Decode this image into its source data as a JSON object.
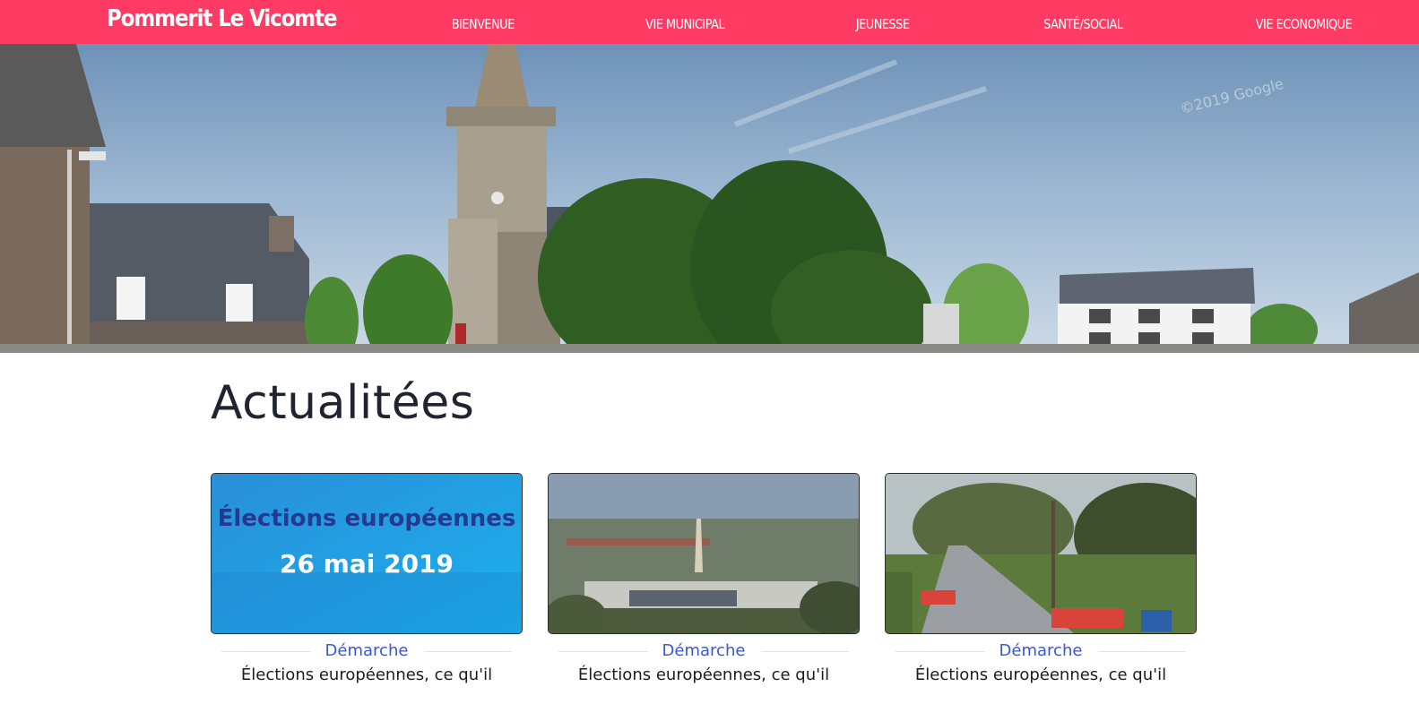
{
  "site": {
    "brand": "Pommerit Le Vicomte"
  },
  "nav": {
    "items": [
      {
        "label": "BIENVENUE"
      },
      {
        "label": "VIE MUNICIPAL"
      },
      {
        "label": "JEUNESSE"
      },
      {
        "label": "SANTÉ/SOCIAL"
      },
      {
        "label": "VIE ECONOMIQUE"
      }
    ]
  },
  "hero": {
    "watermark": "©2019 Google"
  },
  "news": {
    "title": "Actualitées",
    "cards": [
      {
        "category": "Démarche",
        "title": "Élections européennes, ce qu'il",
        "image_line1": "Élections européennes",
        "image_line2": "26 mai 2019"
      },
      {
        "category": "Démarche",
        "title": "Élections européennes, ce qu'il"
      },
      {
        "category": "Démarche",
        "title": "Élections européennes, ce qu'il"
      }
    ]
  },
  "colors": {
    "brand": "#ff3a63",
    "category": "#3b57d6",
    "heading": "#1f2430"
  }
}
